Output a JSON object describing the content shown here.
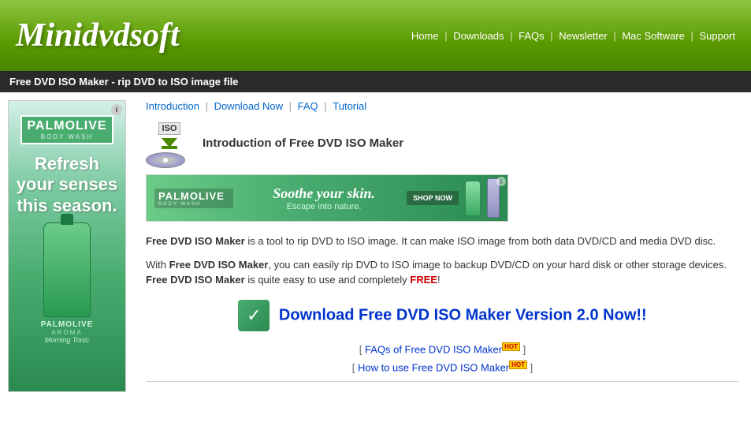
{
  "header": {
    "logo": "Minidvdsoft",
    "nav": {
      "home": "Home",
      "downloads": "Downloads",
      "faqs": "FAQs",
      "newsletter": "Newsletter",
      "mac_software": "Mac Software",
      "support": "Support"
    }
  },
  "page_title": "Free DVD ISO Maker - rip DVD to ISO image file",
  "sub_nav": {
    "introduction": "Introduction",
    "download_now": "Download Now",
    "faq": "FAQ",
    "tutorial": "Tutorial"
  },
  "product": {
    "title": "Introduction of Free DVD ISO Maker",
    "description1": " is a tool to rip DVD to ISO image. It can make ISO image from both data DVD/CD and media DVD disc.",
    "bold1": "Free DVD ISO Maker",
    "description2": ", you can easily rip DVD to ISO image to backup DVD/CD on your hard disk or other storage devices. ",
    "bold2": "Free DVD ISO Maker",
    "bold3": "Free DVD ISO Maker",
    "description3": " is quite easy to use and completely ",
    "free_text": "FREE",
    "description3_end": "!",
    "prefix2": "With "
  },
  "download": {
    "title": "Download Free DVD ISO Maker Version 2.0 Now!!"
  },
  "faq_links": {
    "faq_link": "FAQs of Free DVD ISO Maker",
    "howto_link": "How to use Free DVD ISO Maker",
    "hot": "HOT"
  },
  "sidebar_ad": {
    "brand": "PALMOLIVE",
    "sub": "BODY WASH",
    "tagline": "Refresh your senses this season.",
    "brand2": "PALMOLIVE",
    "sub2": "AROMA",
    "scent": "Morning Tonic"
  },
  "banner_ad": {
    "brand": "PALMOLIVE",
    "sub": "BODY WASH",
    "tagline1": "Soothe your skin.",
    "tagline2": "Escape into nature.",
    "shop_now": "SHOP NOW"
  }
}
